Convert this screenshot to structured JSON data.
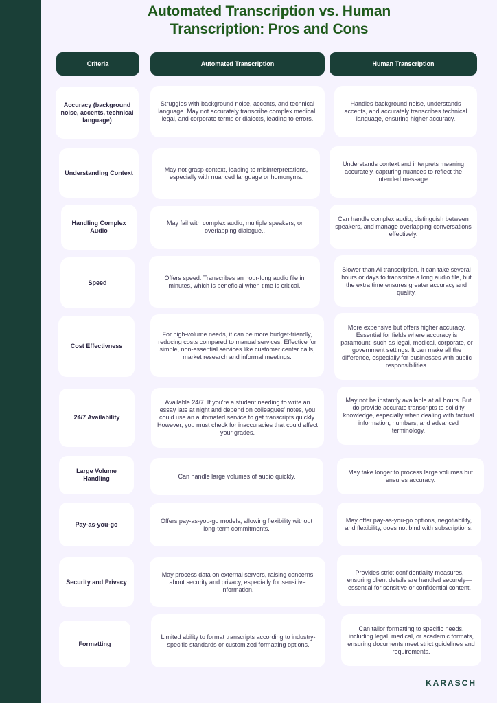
{
  "title": {
    "line1": "Automated Transcription vs. Human",
    "line2": "Transcription: Pros and Cons"
  },
  "headers": {
    "criteria": "Criteria",
    "automated": "Automated Transcription",
    "human": "Human Transcription"
  },
  "rows": [
    {
      "criteria": "Accuracy (background noise, accents, technical language)",
      "automated": "Struggles with background noise, accents, and technical language. May not accurately transcribe complex medical, legal, and corporate terms or dialects, leading to errors.",
      "human": "Handles background noise, understands accents, and accurately transcribes technical language, ensuring higher accuracy."
    },
    {
      "criteria": "Understanding Context",
      "automated": "May not grasp context, leading to misinterpretations, especially with nuanced language or homonyms.",
      "human": "Understands context and interprets meaning accurately, capturing nuances to reflect the intended message."
    },
    {
      "criteria": "Handling Complex Audio",
      "automated": "May fail with complex audio, multiple speakers, or overlapping dialogue..",
      "human": "Can handle complex audio, distinguish between speakers, and manage overlapping conversations effectively."
    },
    {
      "criteria": "Speed",
      "automated": "Offers speed. Transcribes an hour-long audio file in minutes, which is beneficial when time is critical.",
      "human": "Slower than AI transcription. It can take several hours or days to transcribe a long audio file, but the extra time ensures greater accuracy and quality."
    },
    {
      "criteria": "Cost Effectivness",
      "automated": "For high-volume needs, it can be more budget-friendly, reducing costs compared to manual services. Effective for simple, non-essential services like customer center calls, market research and informal meetings.",
      "human": "More expensive but offers higher accuracy. Essential for fields where accuracy is paramount, such as legal, medical, corporate, or government settings. It can make all the difference, especially for businesses with public responsibilities."
    },
    {
      "criteria": "24/7 Availability",
      "automated": "Available 24/7. If you're a student needing to write an essay late at night and depend on colleagues' notes, you could use an automated service to get transcripts quickly. However, you must check for inaccuracies that could affect your grades.",
      "human": "May not be instantly available at all hours. But do provide accurate transcripts to solidify knowledge, especially when dealing with factual information, numbers, and advanced terminology."
    },
    {
      "criteria": "Large Volume Handling",
      "automated": "Can handle large volumes of audio quickly.",
      "human": "May take longer to process large volumes but ensures accuracy."
    },
    {
      "criteria": "Pay-as-you-go",
      "automated": "Offers pay-as-you-go models, allowing flexibility without long-term commitments.",
      "human": "May offer pay-as-you-go options, negotiability, and flexibility, does not bind with subscriptions."
    },
    {
      "criteria": "Security and Privacy",
      "automated": "May process data on external servers, raising concerns about security and privacy, especially for sensitive information.",
      "human": "Provides strict confidentiality measures, ensuring client details are handled securely—essential for sensitive or confidential content."
    },
    {
      "criteria": "Formatting",
      "automated": "Limited ability to format transcripts according to industry-specific standards or customized formatting options.",
      "human": "Can tailor formatting to specific needs, including legal, medical, or academic formats, ensuring documents meet strict guidelines and requirements."
    }
  ],
  "brand": {
    "logo_text": "KARASCH",
    "primary_color": "#1a3f37",
    "title_color": "#1f5a1c",
    "background_color": "#f6f3fe"
  }
}
